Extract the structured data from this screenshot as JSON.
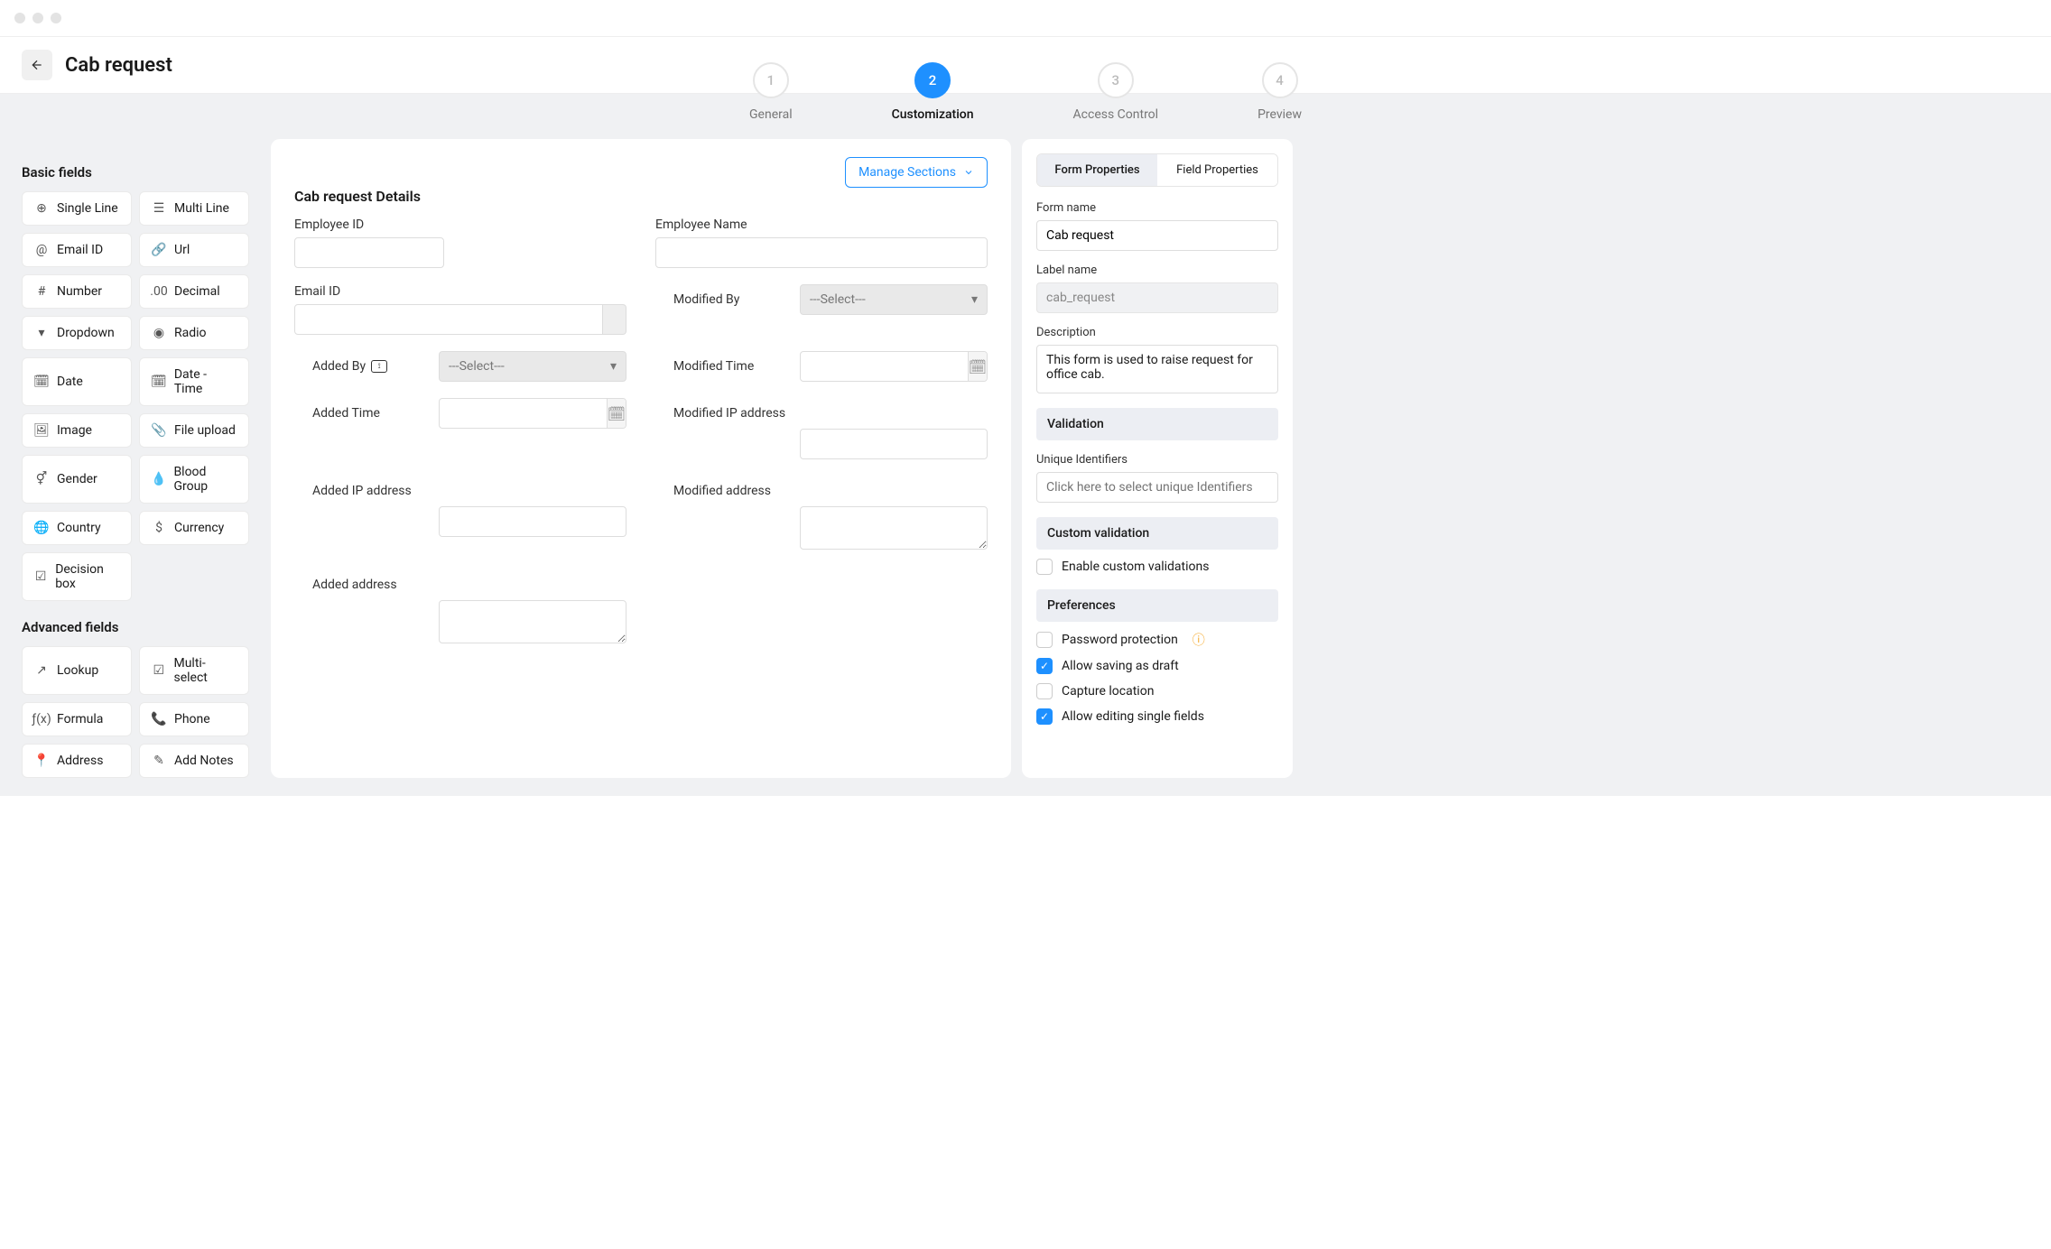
{
  "pageTitle": "Cab request",
  "steps": [
    {
      "num": "1",
      "label": "General"
    },
    {
      "num": "2",
      "label": "Customization"
    },
    {
      "num": "3",
      "label": "Access Control"
    },
    {
      "num": "4",
      "label": "Preview"
    }
  ],
  "activeStep": 1,
  "basicFieldsHeading": "Basic fields",
  "basicFields": [
    {
      "icon": "⊕",
      "label": "Single Line"
    },
    {
      "icon": "☰",
      "label": "Multi Line"
    },
    {
      "icon": "@",
      "label": "Email ID"
    },
    {
      "icon": "🔗",
      "label": "Url"
    },
    {
      "icon": "#",
      "label": "Number"
    },
    {
      "icon": ".00",
      "label": "Decimal"
    },
    {
      "icon": "▾",
      "label": "Dropdown"
    },
    {
      "icon": "◉",
      "label": "Radio"
    },
    {
      "icon": "🗓",
      "label": "Date"
    },
    {
      "icon": "🗓",
      "label": "Date - Time"
    },
    {
      "icon": "🖼",
      "label": "Image"
    },
    {
      "icon": "📎",
      "label": "File upload"
    },
    {
      "icon": "⚥",
      "label": "Gender"
    },
    {
      "icon": "💧",
      "label": "Blood Group"
    },
    {
      "icon": "🌐",
      "label": "Country"
    },
    {
      "icon": "$",
      "label": "Currency"
    },
    {
      "icon": "☑",
      "label": "Decision box"
    }
  ],
  "advancedFieldsHeading": "Advanced fields",
  "advancedFields": [
    {
      "icon": "↗",
      "label": "Lookup"
    },
    {
      "icon": "☑",
      "label": "Multi-select"
    },
    {
      "icon": "ƒ(x)",
      "label": "Formula"
    },
    {
      "icon": "📞",
      "label": "Phone"
    },
    {
      "icon": "📍",
      "label": "Address"
    },
    {
      "icon": "✎",
      "label": "Add Notes"
    }
  ],
  "manageSections": "Manage Sections",
  "sectionTitle": "Cab request Details",
  "formFields": {
    "employeeId": "Employee ID",
    "employeeName": "Employee Name",
    "emailId": "Email ID",
    "modifiedBy": "Modified By",
    "addedBy": "Added By",
    "modifiedTime": "Modified Time",
    "addedTime": "Added Time",
    "modifiedIp": "Modified IP address",
    "addedIp": "Added IP address",
    "modifiedAddress": "Modified address",
    "addedAddress": "Added address",
    "selectPlaceholder": "---Select---"
  },
  "propTabs": {
    "form": "Form Properties",
    "field": "Field Properties"
  },
  "props": {
    "formNameLabel": "Form name",
    "formName": "Cab request",
    "labelNameLabel": "Label name",
    "labelName": "cab_request",
    "descriptionLabel": "Description",
    "description": "This form is used to raise request for office cab.",
    "validationHeading": "Validation",
    "uniqueLabel": "Unique Identifiers",
    "uniquePlaceholder": "Click here to select unique Identifiers",
    "customValidationHeading": "Custom validation",
    "enableCustom": "Enable custom validations",
    "preferencesHeading": "Preferences",
    "passwordProtection": "Password protection",
    "allowDraft": "Allow saving as draft",
    "captureLocation": "Capture location",
    "allowEditSingle": "Allow editing single fields"
  }
}
